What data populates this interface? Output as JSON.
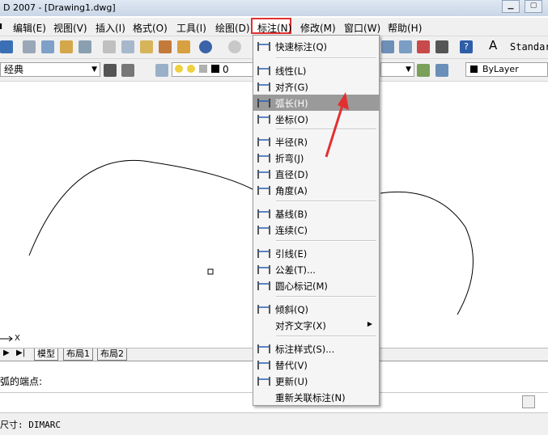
{
  "window": {
    "title": "D 2007 - [Drawing1.dwg]"
  },
  "menubar": {
    "items": [
      "编辑(E)",
      "视图(V)",
      "插入(I)",
      "格式(O)",
      "工具(I)",
      "绘图(D)",
      "标注(N)",
      "修改(M)",
      "窗口(W)",
      "帮助(H)"
    ],
    "active": "标注(N)"
  },
  "toolbar": {
    "workspace": "经典",
    "layer_value": "0",
    "text_style": "Standar",
    "linetype": "ByLayer"
  },
  "dimension_menu": {
    "items": [
      {
        "label": "快速标注(Q)",
        "icon": "quick-dimension-icon"
      },
      {
        "label": "线性(L)",
        "icon": "linear-icon"
      },
      {
        "label": "对齐(G)",
        "icon": "aligned-icon"
      },
      {
        "label": "弧长(H)",
        "icon": "arc-length-icon",
        "highlighted": true
      },
      {
        "label": "坐标(O)",
        "icon": "ordinate-icon"
      },
      {
        "label": "半径(R)",
        "icon": "radius-icon"
      },
      {
        "label": "折弯(J)",
        "icon": "jogged-icon"
      },
      {
        "label": "直径(D)",
        "icon": "diameter-icon"
      },
      {
        "label": "角度(A)",
        "icon": "angular-icon"
      },
      {
        "label": "基线(B)",
        "icon": "baseline-icon"
      },
      {
        "label": "连续(C)",
        "icon": "continue-icon"
      },
      {
        "label": "引线(E)",
        "icon": "leader-icon"
      },
      {
        "label": "公差(T)...",
        "icon": "tolerance-icon"
      },
      {
        "label": "圆心标记(M)",
        "icon": "center-mark-icon"
      },
      {
        "label": "倾斜(Q)",
        "icon": "oblique-icon"
      },
      {
        "label": "对齐文字(X)",
        "icon": "",
        "submenu": true
      },
      {
        "label": "标注样式(S)...",
        "icon": "dimension-style-icon"
      },
      {
        "label": "替代(V)",
        "icon": "override-icon"
      },
      {
        "label": "更新(U)",
        "icon": "update-icon"
      },
      {
        "label": "重新关联标注(N)",
        "icon": ""
      }
    ]
  },
  "layout_tabs": [
    "模型",
    "布局1",
    "布局2"
  ],
  "ucs_label": "X",
  "command": {
    "prompt": "弧的端点:",
    "last_command": "尺寸: DIMARC"
  },
  "colors": {
    "highlight": "#9a9a9a",
    "annotation_red": "#e23030",
    "menubar": "#f0f0f0"
  }
}
